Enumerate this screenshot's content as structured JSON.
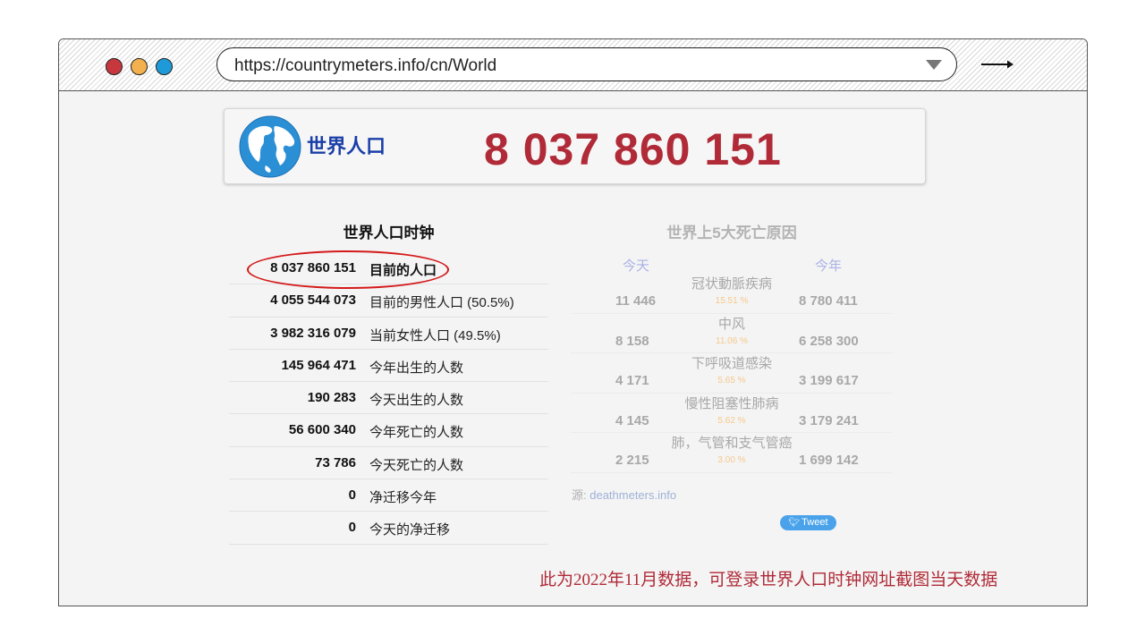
{
  "browser": {
    "url": "https://countrymeters.info/cn/World",
    "window_buttons": [
      {
        "name": "close",
        "color": "#c7373e"
      },
      {
        "name": "minimize",
        "color": "#f2b14e"
      },
      {
        "name": "maximize",
        "color": "#1f9ad8"
      }
    ]
  },
  "header": {
    "title": "世界人口",
    "population": "8 037 860 151",
    "icon": "globe-icon"
  },
  "clock": {
    "title": "世界人口时钟",
    "rows": [
      {
        "value": "8 037 860 151",
        "label": "目前的人口"
      },
      {
        "value": "4 055 544 073",
        "label": "目前的男性人口 (50.5%)"
      },
      {
        "value": "3 982 316 079",
        "label": "当前女性人口 (49.5%)"
      },
      {
        "value": "145 964 471",
        "label": "今年出生的人数"
      },
      {
        "value": "190 283",
        "label": "今天出生的人数"
      },
      {
        "value": "56 600 340",
        "label": "今年死亡的人数"
      },
      {
        "value": "73 786",
        "label": "今天死亡的人数"
      },
      {
        "value": "0",
        "label": "净迁移今年"
      },
      {
        "value": "0",
        "label": "今天的净迁移"
      }
    ]
  },
  "death_causes": {
    "title": "世界上5大死亡原因",
    "col_today": "今天",
    "col_year": "今年",
    "rows": [
      {
        "cause": "冠状動脈疾病",
        "today": "11 446",
        "percent": "15.51 %",
        "year": "8 780 411"
      },
      {
        "cause": "中风",
        "today": "8 158",
        "percent": "11.06 %",
        "year": "6 258 300"
      },
      {
        "cause": "下呼吸道感染",
        "today": "4 171",
        "percent": "5.65 %",
        "year": "3 199 617"
      },
      {
        "cause": "慢性阻塞性肺病",
        "today": "4 145",
        "percent": "5.62 %",
        "year": "3 179 241"
      },
      {
        "cause": "肺，气管和支气管癌",
        "today": "2 215",
        "percent": "3.00 %",
        "year": "1 699 142"
      }
    ],
    "source_label": "源: ",
    "source_link": "deathmeters.info"
  },
  "tweet_button": {
    "label": "Tweet",
    "icon": "twitter-bird-icon"
  },
  "note": "此为2022年11月数据，可登录世界人口时钟网址截图当天数据",
  "colors": {
    "population_red": "#b02a37",
    "title_blue": "#1a3fa8",
    "highlight_ellipse": "#d41a1a",
    "tweet_blue": "#4aa3ea"
  }
}
